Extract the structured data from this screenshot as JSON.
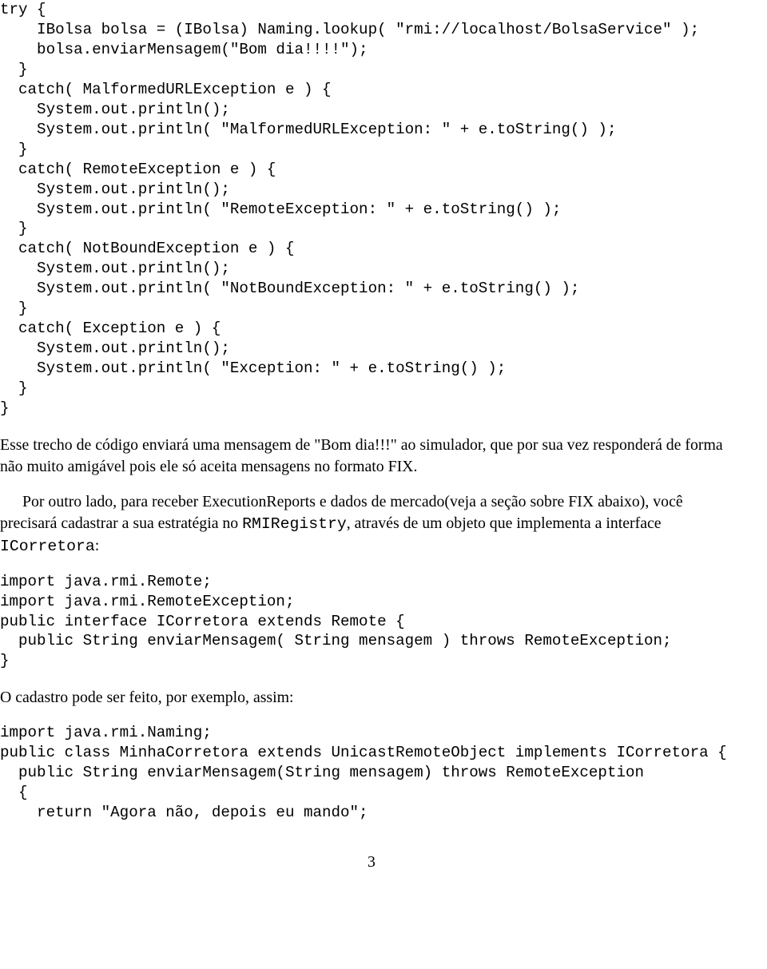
{
  "code1": "try {\n    IBolsa bolsa = (IBolsa) Naming.lookup( \"rmi://localhost/BolsaService\" );\n    bolsa.enviarMensagem(\"Bom dia!!!!\");\n  }\n  catch( MalformedURLException e ) {\n    System.out.println();\n    System.out.println( \"MalformedURLException: \" + e.toString() );\n  }\n  catch( RemoteException e ) {\n    System.out.println();\n    System.out.println( \"RemoteException: \" + e.toString() );\n  }\n  catch( NotBoundException e ) {\n    System.out.println();\n    System.out.println( \"NotBoundException: \" + e.toString() );\n  }\n  catch( Exception e ) {\n    System.out.println();\n    System.out.println( \"Exception: \" + e.toString() );\n  }\n}",
  "p1_a": "Esse trecho de código enviará uma mensagem de \"Bom dia!!!\" ao simulador, que por sua vez responderá de forma não muito amigável pois ele só aceita mensagens no formato FIX.",
  "p1_b_prefix": "Por outro lado, para receber ExecutionReports e dados de mercado(veja a seção sobre FIX abaixo), você precisará cadastrar a sua estratégia no ",
  "p1_b_mono1": "RMIRegistry",
  "p1_b_mid": ", através de um objeto que implementa a interface ",
  "p1_b_mono2": "ICorretora",
  "p1_b_suffix": ":",
  "code2": "import java.rmi.Remote;\nimport java.rmi.RemoteException;\npublic interface ICorretora extends Remote {\n  public String enviarMensagem( String mensagem ) throws RemoteException;\n}",
  "p2": "O cadastro pode ser feito, por exemplo, assim:",
  "code3": "import java.rmi.Naming;\npublic class MinhaCorretora extends UnicastRemoteObject implements ICorretora {\n  public String enviarMensagem(String mensagem) throws RemoteException\n  {\n    return \"Agora não, depois eu mando\";",
  "page_number": "3"
}
